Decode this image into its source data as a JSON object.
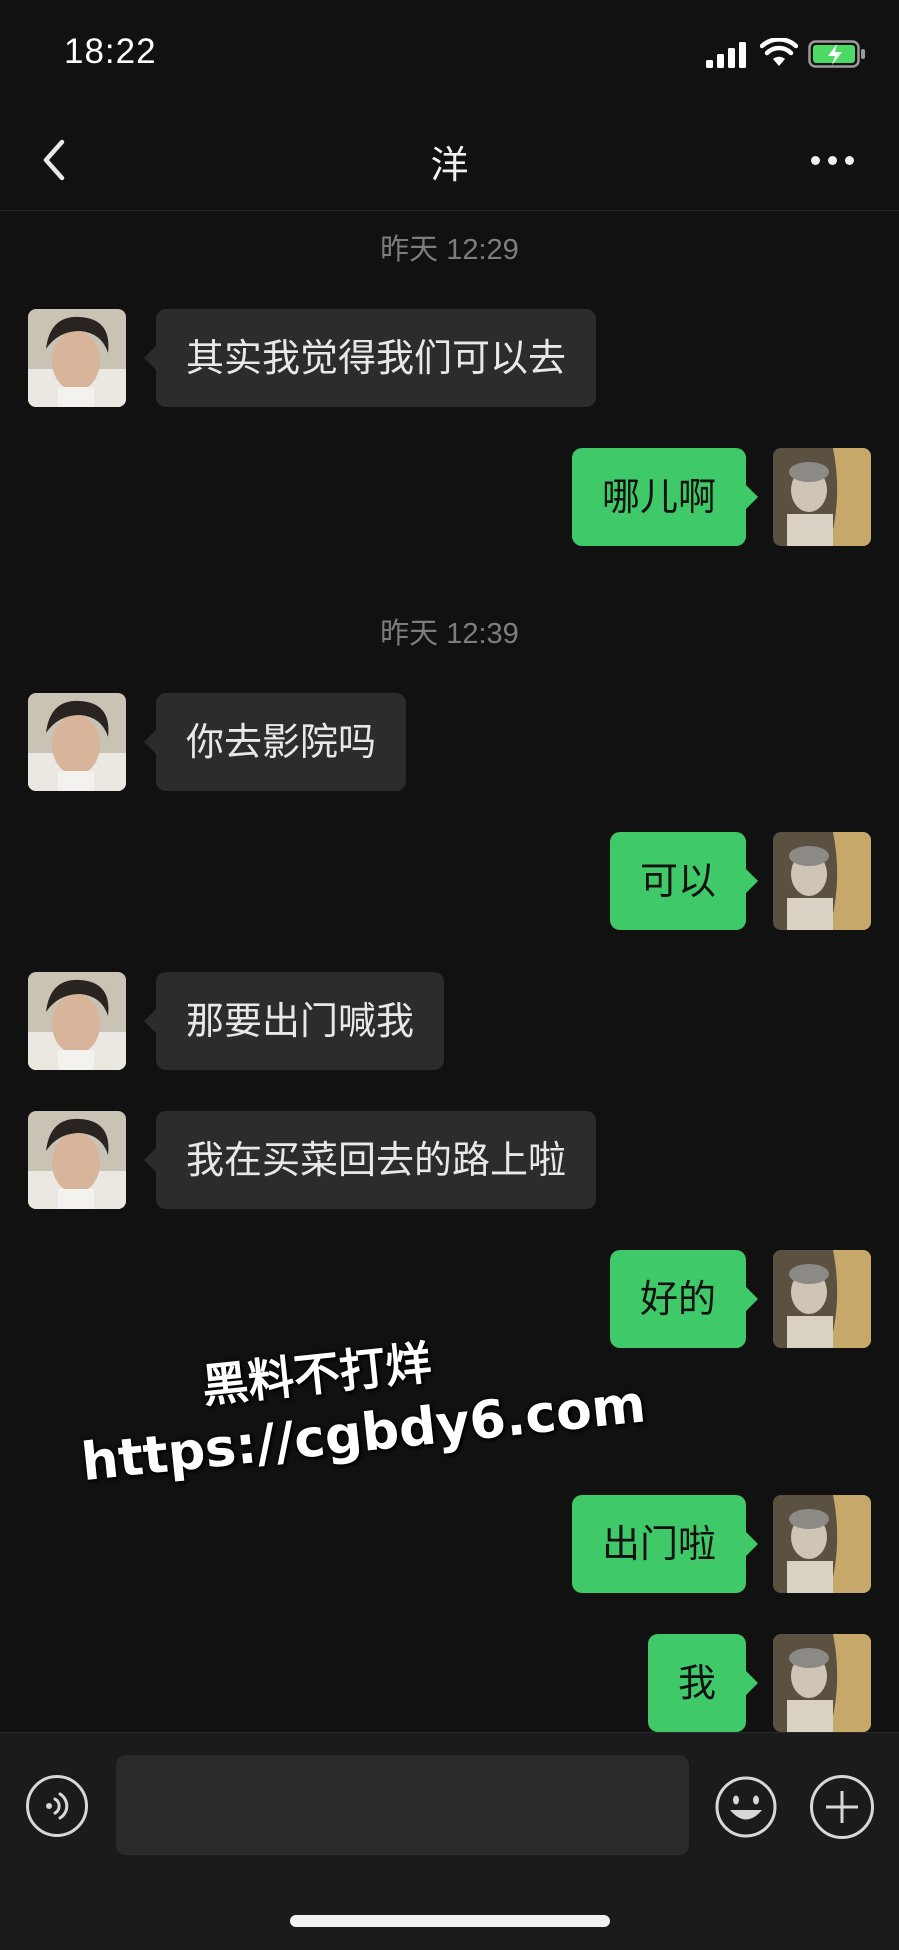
{
  "status": {
    "time": "18:22"
  },
  "header": {
    "title": "洋",
    "back_icon": "chevron-left-icon",
    "more_icon": "more-dots-icon"
  },
  "timestamps": [
    "昨天 12:29",
    "昨天 12:39"
  ],
  "messages": [
    {
      "side": "in",
      "text": "其实我觉得我们可以去"
    },
    {
      "side": "out",
      "text": "哪儿啊"
    },
    {
      "side": "in",
      "text": "你去影院吗"
    },
    {
      "side": "out",
      "text": "可以"
    },
    {
      "side": "in",
      "text": "那要出门喊我"
    },
    {
      "side": "in",
      "text": "我在买菜回去的路上啦"
    },
    {
      "side": "out",
      "text": "好的"
    },
    {
      "side": "out",
      "text": "出门啦"
    },
    {
      "side": "out",
      "text": "我"
    }
  ],
  "watermark": {
    "line1": "黑料不打烊",
    "line2": "https://cgbdy6.com"
  },
  "input": {
    "placeholder": ""
  },
  "colors": {
    "background": "#111111",
    "incoming_bubble": "#2c2c2c",
    "outgoing_bubble": "#3fc968",
    "battery": "#4cd964"
  }
}
